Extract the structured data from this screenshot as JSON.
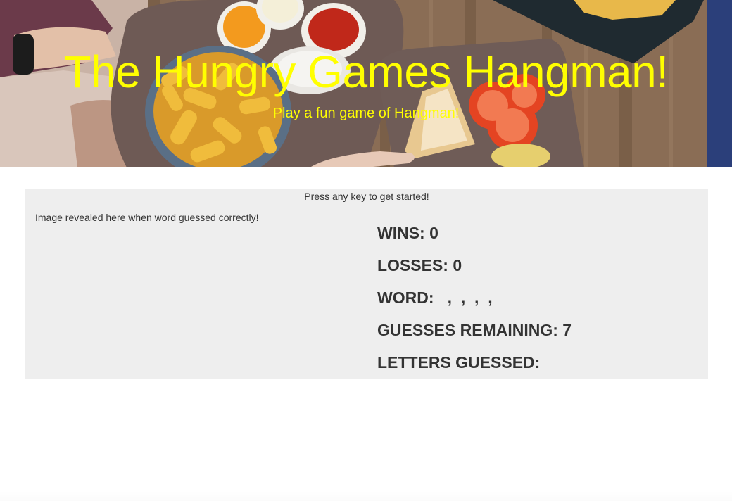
{
  "hero": {
    "title": "The Hungry Games Hangman!",
    "subtitle": "Play a fun game of Hangman!",
    "title_color": "#ffff00"
  },
  "game": {
    "start_message": "Press any key to get started!",
    "reveal_message": "Image revealed here when word guessed correctly!",
    "wins_label": "WINS:",
    "wins_value": "0",
    "losses_label": "LOSSES:",
    "losses_value": "0",
    "word_label": "WORD:",
    "word_value": "_,_,_,_,_",
    "guesses_label": "GUESSES REMAINING:",
    "guesses_value": "7",
    "letters_label": "LETTERS GUESSED:",
    "letters_value": ""
  },
  "colors": {
    "panel_bg": "#eeeeee",
    "text": "#333333"
  }
}
